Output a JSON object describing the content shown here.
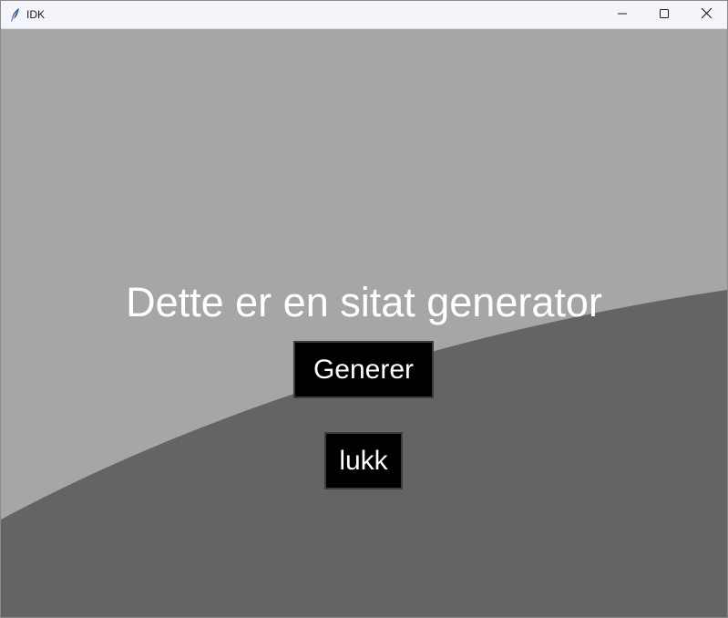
{
  "window": {
    "title": "IDK",
    "icons": {
      "app": "feather-icon",
      "minimize": "minimize-icon",
      "maximize": "maximize-icon",
      "close": "close-icon"
    }
  },
  "main": {
    "heading": "Dette er en sitat generator",
    "generate_label": "Generer",
    "close_label": "lukk"
  },
  "colors": {
    "background_light": "#a6a6a6",
    "background_dark": "#646464",
    "button_bg": "#000000",
    "text": "#ffffff"
  }
}
